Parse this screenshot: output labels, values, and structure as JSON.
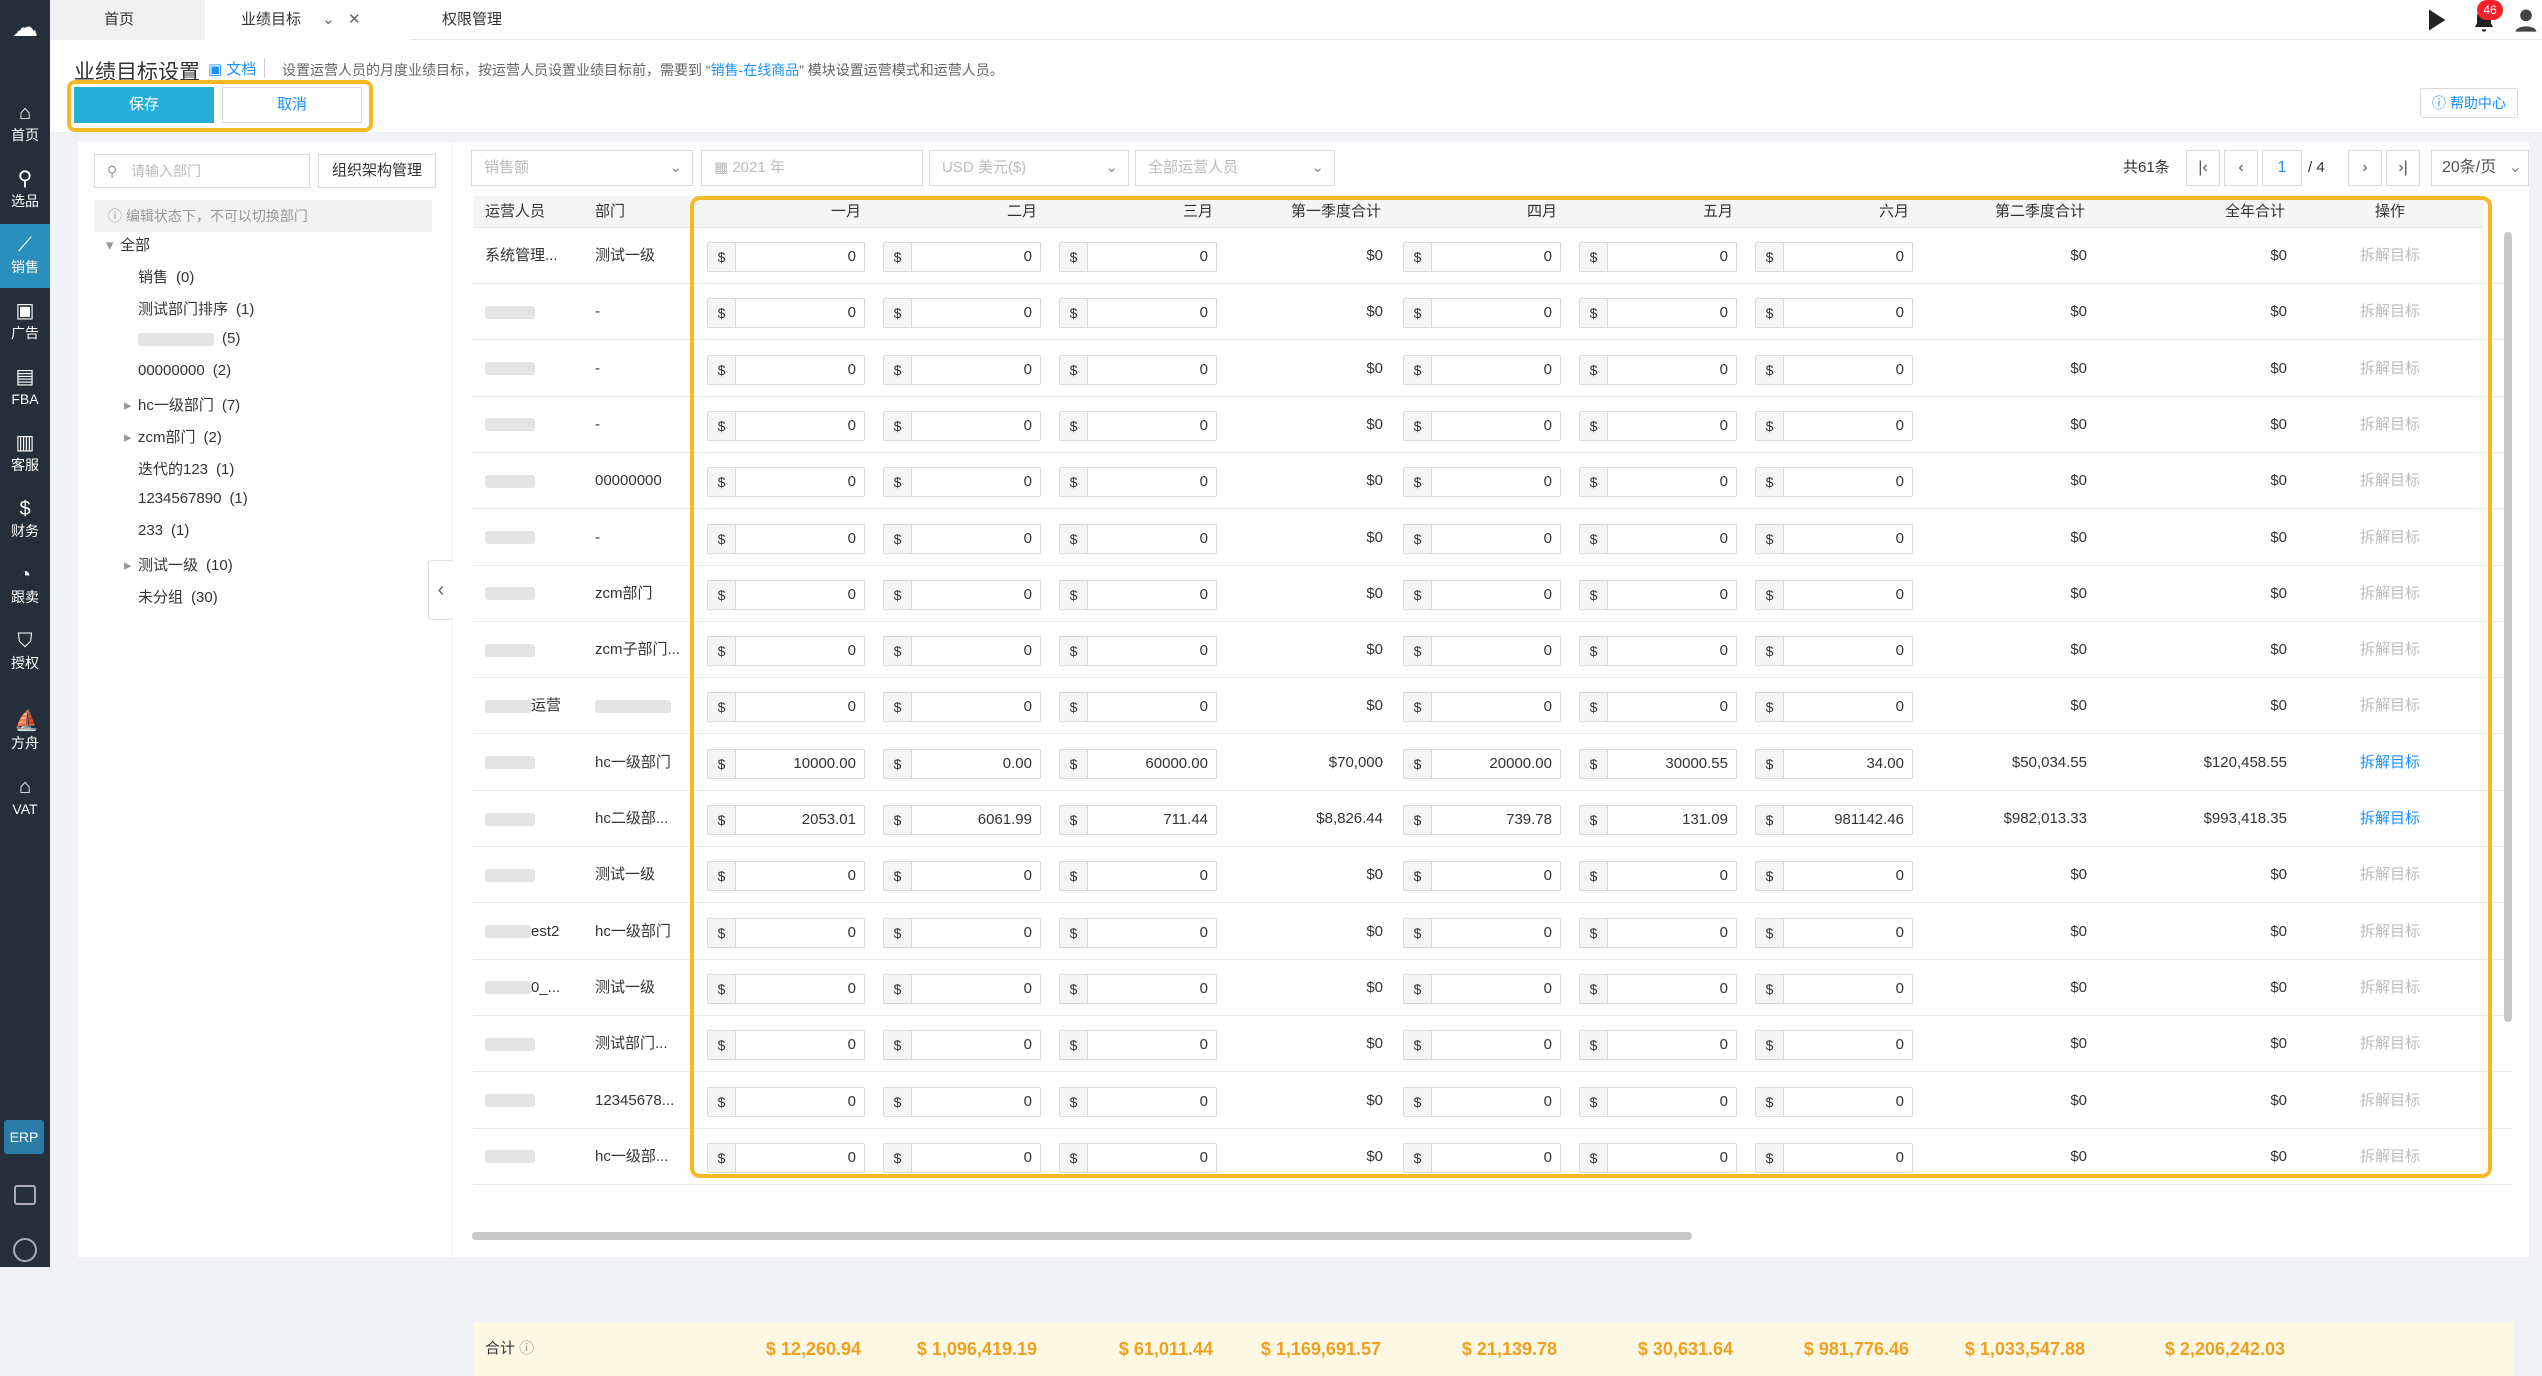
{
  "sidebar": {
    "items": [
      {
        "label": "首页",
        "icon": "home-icon"
      },
      {
        "label": "选品",
        "icon": "search-icon"
      },
      {
        "label": "销售",
        "icon": "chart-line-icon",
        "active": true
      },
      {
        "label": "广告",
        "icon": "ad-icon"
      },
      {
        "label": "FBA",
        "icon": "fba-icon"
      },
      {
        "label": "客服",
        "icon": "service-icon"
      },
      {
        "label": "财务",
        "icon": "finance-icon"
      },
      {
        "label": "跟卖",
        "icon": "follow-icon"
      },
      {
        "label": "授权",
        "icon": "shield-icon"
      },
      {
        "label": "方舟",
        "icon": "ark-icon"
      },
      {
        "label": "VAT",
        "icon": "vat-icon"
      }
    ],
    "erp": "ERP"
  },
  "tabs": [
    {
      "label": "首页"
    },
    {
      "label": "业绩目标"
    },
    {
      "label": "权限管理"
    }
  ],
  "top": {
    "badge": "46"
  },
  "header": {
    "title": "业绩目标设置",
    "doc_link": "文档",
    "desc_prefix": "设置运营人员的月度业绩目标，按运营人员设置业绩目标前，需要到 “",
    "desc_link": "销售-在线商品",
    "desc_suffix": "” 模块设置运营模式和运营人员。",
    "save": "保存",
    "cancel": "取消",
    "help": "帮助中心"
  },
  "dept": {
    "search_placeholder": "请输入部门",
    "org_button": "组织架构管理",
    "note": "编辑状态下，不可以切换部门",
    "tree": [
      {
        "label": "全部",
        "count": "",
        "level": 0,
        "arrow": "▾"
      },
      {
        "label": "销售",
        "count": "(0)",
        "level": 1,
        "arrow": ""
      },
      {
        "label": "测试部门排序",
        "count": "(1)",
        "level": 1,
        "arrow": ""
      },
      {
        "label": "",
        "count": "(5)",
        "level": 1,
        "arrow": "",
        "blur": true
      },
      {
        "label": "00000000",
        "count": "(2)",
        "level": 1,
        "arrow": ""
      },
      {
        "label": "hc一级部门",
        "count": "(7)",
        "level": 1,
        "arrow": "▸"
      },
      {
        "label": "zcm部门",
        "count": "(2)",
        "level": 1,
        "arrow": "▸"
      },
      {
        "label": "迭代的123",
        "count": "(1)",
        "level": 1,
        "arrow": ""
      },
      {
        "label": "1234567890",
        "count": "(1)",
        "level": 1,
        "arrow": ""
      },
      {
        "label": "233",
        "count": "(1)",
        "level": 1,
        "arrow": ""
      },
      {
        "label": "测试一级",
        "count": "(10)",
        "level": 1,
        "arrow": "▸"
      },
      {
        "label": "未分组",
        "count": "(30)",
        "level": 1,
        "arrow": ""
      }
    ]
  },
  "filters": {
    "metric": "销售额",
    "year": "2021 年",
    "currency": "USD  美元($)",
    "staff": "全部运营人员"
  },
  "pager": {
    "total": "共61条",
    "page": "1",
    "pages": "/ 4",
    "size": "20条/页"
  },
  "table": {
    "headers": [
      "运营人员",
      "部门",
      "一月",
      "二月",
      "三月",
      "第一季度合计",
      "四月",
      "五月",
      "六月",
      "第二季度合计",
      "全年合计",
      "操作"
    ],
    "rows": [
      {
        "staff": "系统管理...",
        "dept": "测试一级",
        "m": [
          "0",
          "0",
          "0"
        ],
        "q1": "$0",
        "m2": [
          "0",
          "0",
          "0"
        ],
        "q2": "$0",
        "total": "$0",
        "action": "拆解目标",
        "on": false
      },
      {
        "staff": "",
        "dept": "-",
        "m": [
          "0",
          "0",
          "0"
        ],
        "q1": "$0",
        "m2": [
          "0",
          "0",
          "0"
        ],
        "q2": "$0",
        "total": "$0",
        "action": "拆解目标",
        "on": false
      },
      {
        "staff": "",
        "dept": "-",
        "m": [
          "0",
          "0",
          "0"
        ],
        "q1": "$0",
        "m2": [
          "0",
          "0",
          "0"
        ],
        "q2": "$0",
        "total": "$0",
        "action": "拆解目标",
        "on": false
      },
      {
        "staff": "",
        "dept": "-",
        "m": [
          "0",
          "0",
          "0"
        ],
        "q1": "$0",
        "m2": [
          "0",
          "0",
          "0"
        ],
        "q2": "$0",
        "total": "$0",
        "action": "拆解目标",
        "on": false
      },
      {
        "staff": "",
        "dept": "00000000",
        "m": [
          "0",
          "0",
          "0"
        ],
        "q1": "$0",
        "m2": [
          "0",
          "0",
          "0"
        ],
        "q2": "$0",
        "total": "$0",
        "action": "拆解目标",
        "on": false
      },
      {
        "staff": "",
        "dept": "-",
        "m": [
          "0",
          "0",
          "0"
        ],
        "q1": "$0",
        "m2": [
          "0",
          "0",
          "0"
        ],
        "q2": "$0",
        "total": "$0",
        "action": "拆解目标",
        "on": false
      },
      {
        "staff": "",
        "dept": "zcm部门",
        "m": [
          "0",
          "0",
          "0"
        ],
        "q1": "$0",
        "m2": [
          "0",
          "0",
          "0"
        ],
        "q2": "$0",
        "total": "$0",
        "action": "拆解目标",
        "on": false
      },
      {
        "staff": "",
        "dept": "zcm子部门...",
        "m": [
          "0",
          "0",
          "0"
        ],
        "q1": "$0",
        "m2": [
          "0",
          "0",
          "0"
        ],
        "q2": "$0",
        "total": "$0",
        "action": "拆解目标",
        "on": false
      },
      {
        "staff": "运营",
        "dept": "",
        "m": [
          "0",
          "0",
          "0"
        ],
        "q1": "$0",
        "m2": [
          "0",
          "0",
          "0"
        ],
        "q2": "$0",
        "total": "$0",
        "action": "拆解目标",
        "on": false
      },
      {
        "staff": "",
        "dept": "hc一级部门",
        "m": [
          "10000.00",
          "0.00",
          "60000.00"
        ],
        "q1": "$70,000",
        "m2": [
          "20000.00",
          "30000.55",
          "34.00"
        ],
        "q2": "$50,034.55",
        "total": "$120,458.55",
        "action": "拆解目标",
        "on": true
      },
      {
        "staff": "",
        "dept": "hc二级部...",
        "m": [
          "2053.01",
          "6061.99",
          "711.44"
        ],
        "q1": "$8,826.44",
        "m2": [
          "739.78",
          "131.09",
          "981142.46"
        ],
        "q2": "$982,013.33",
        "total": "$993,418.35",
        "action": "拆解目标",
        "on": true
      },
      {
        "staff": "",
        "dept": "测试一级",
        "m": [
          "0",
          "0",
          "0"
        ],
        "q1": "$0",
        "m2": [
          "0",
          "0",
          "0"
        ],
        "q2": "$0",
        "total": "$0",
        "action": "拆解目标",
        "on": false
      },
      {
        "staff": "est2",
        "dept": "hc一级部门",
        "m": [
          "0",
          "0",
          "0"
        ],
        "q1": "$0",
        "m2": [
          "0",
          "0",
          "0"
        ],
        "q2": "$0",
        "total": "$0",
        "action": "拆解目标",
        "on": false
      },
      {
        "staff": "0_...",
        "dept": "测试一级",
        "m": [
          "0",
          "0",
          "0"
        ],
        "q1": "$0",
        "m2": [
          "0",
          "0",
          "0"
        ],
        "q2": "$0",
        "total": "$0",
        "action": "拆解目标",
        "on": false
      },
      {
        "staff": "",
        "dept": "测试部门...",
        "m": [
          "0",
          "0",
          "0"
        ],
        "q1": "$0",
        "m2": [
          "0",
          "0",
          "0"
        ],
        "q2": "$0",
        "total": "$0",
        "action": "拆解目标",
        "on": false
      },
      {
        "staff": "",
        "dept": "12345678...",
        "m": [
          "0",
          "0",
          "0"
        ],
        "q1": "$0",
        "m2": [
          "0",
          "0",
          "0"
        ],
        "q2": "$0",
        "total": "$0",
        "action": "拆解目标",
        "on": false
      },
      {
        "staff": "",
        "dept": "hc一级部...",
        "m": [
          "0",
          "0",
          "0"
        ],
        "q1": "$0",
        "m2": [
          "0",
          "0",
          "0"
        ],
        "q2": "$0",
        "total": "$0",
        "action": "拆解目标",
        "on": false
      }
    ],
    "currency_symbol": "$",
    "sum_label": "合计",
    "sums": [
      "$ 12,260.94",
      "$ 1,096,419.19",
      "$ 61,011.44",
      "$ 1,169,691.57",
      "$ 21,139.78",
      "$ 30,631.64",
      "$ 981,776.46",
      "$ 1,033,547.88",
      "$ 2,206,242.03"
    ]
  },
  "colors": {
    "accent": "#27aed8",
    "sidebar": "#252f3b",
    "highlight": "#f5b925",
    "sum": "#f0a020"
  }
}
